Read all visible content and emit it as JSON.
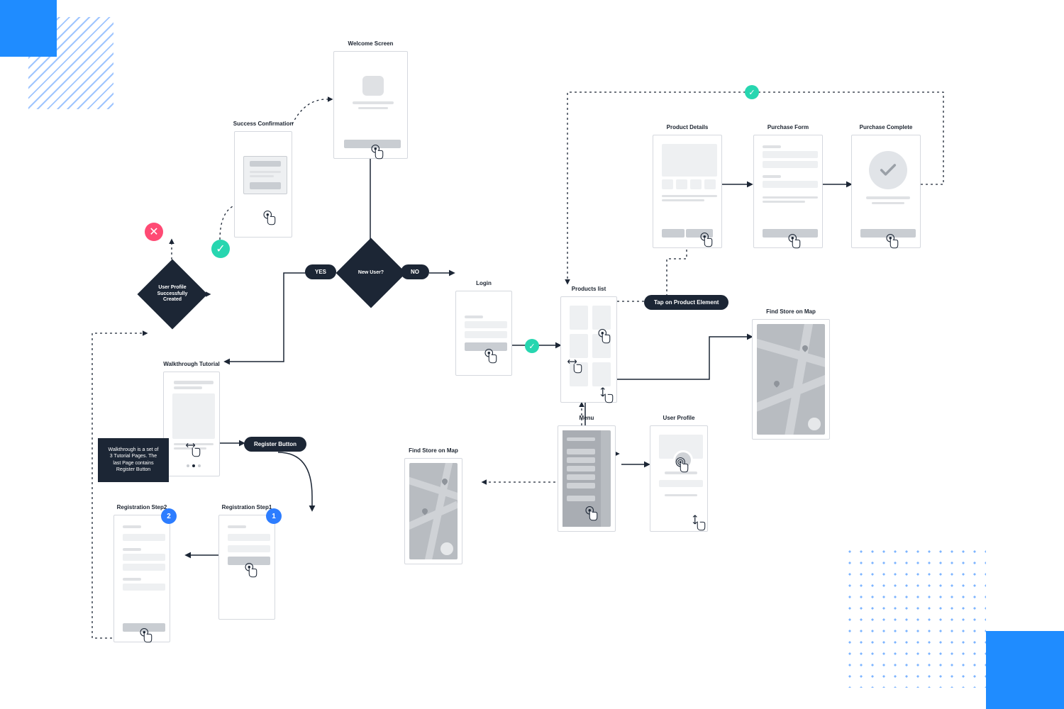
{
  "screens": {
    "welcome": "Welcome Screen",
    "successConfirmation": "Success Confirmation",
    "walkthrough": "Walkthrough Tutorial",
    "regStep1": "Registration Step1",
    "regStep2": "Registration Step2",
    "login": "Login",
    "productsList": "Products list",
    "productDetails": "Product Details",
    "purchaseForm": "Purchase Form",
    "purchaseComplete": "Purchase Complete",
    "menu": "Menu",
    "userProfile": "User Profile",
    "findStoreMap1": "Find Store on Map",
    "findStoreMap2": "Find Store on Map"
  },
  "decisions": {
    "newUser": "New User?",
    "profileCreated": "User Profile Successfully Created"
  },
  "labels": {
    "yes": "YES",
    "no": "NO",
    "registerButton": "Register Button",
    "tapOnProduct": "Tap on Product Element"
  },
  "note": {
    "walkthrough": "Walkthrough is a set of 3 Tutorial Pages. The last Page contains Register Button"
  },
  "badges": {
    "step1": "1",
    "step2": "2"
  },
  "icons": {
    "check": "✓",
    "close": "✕"
  }
}
